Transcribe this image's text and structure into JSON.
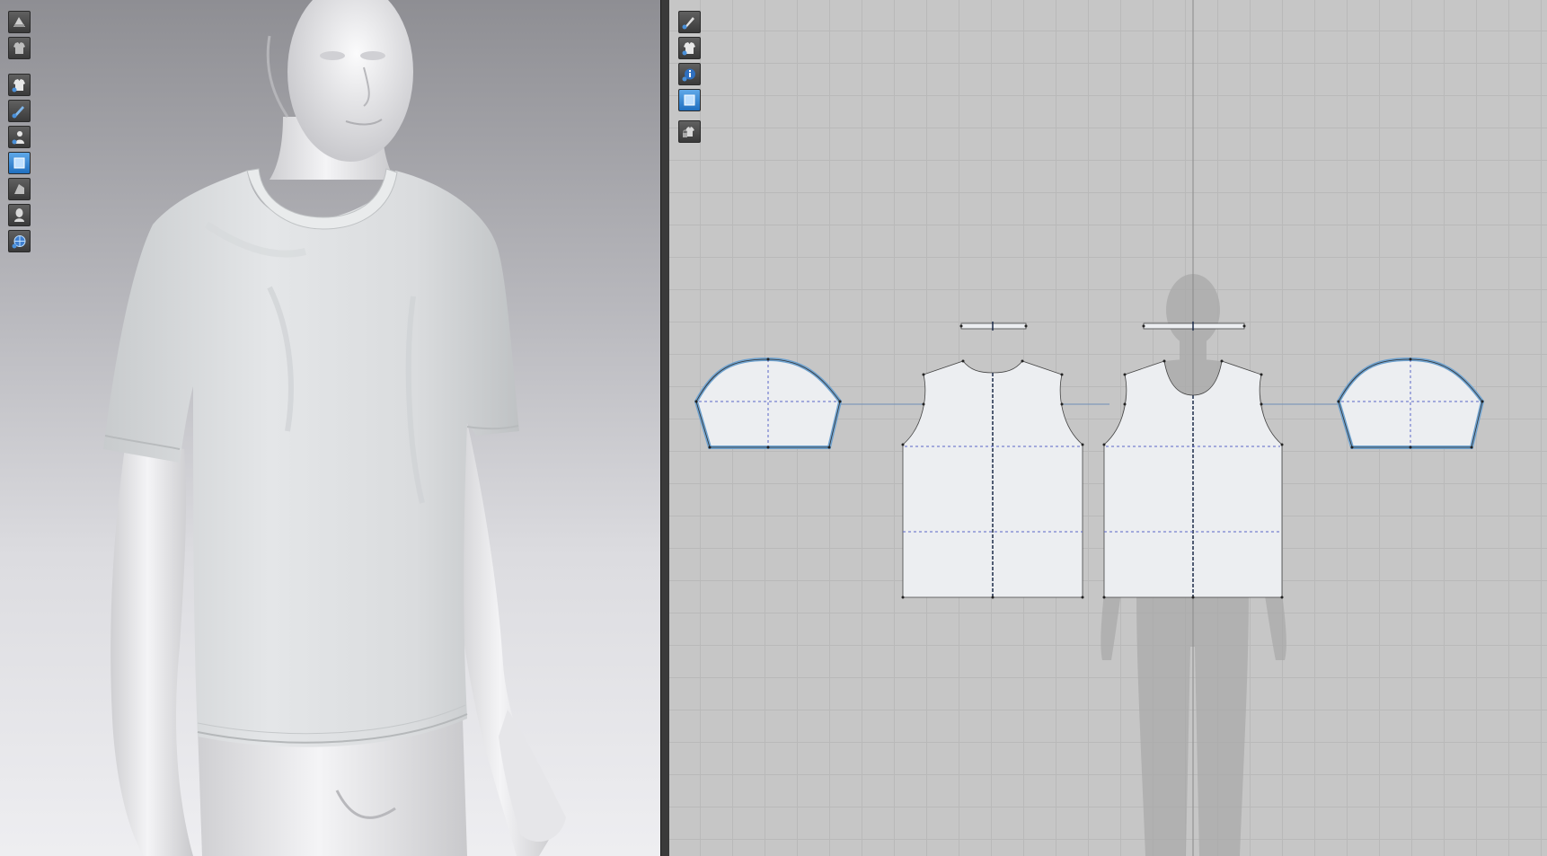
{
  "app": {
    "panes": [
      "3d-garment-view",
      "2d-pattern-view"
    ]
  },
  "toolbar_3d": {
    "buttons": [
      {
        "icon": "fabric-render-icon",
        "active": false
      },
      {
        "icon": "garment-display-icon",
        "active": false
      },
      {
        "icon": "show-garment-icon",
        "active": false
      },
      {
        "icon": "show-brush-icon",
        "active": false
      },
      {
        "icon": "show-avatar-icon",
        "active": false
      },
      {
        "icon": "texture-view-icon",
        "active": true
      },
      {
        "icon": "shading-mode-icon",
        "active": false
      },
      {
        "icon": "avatar-silhouette-icon",
        "active": false
      },
      {
        "icon": "mesh-globe-icon",
        "active": false
      }
    ]
  },
  "toolbar_2d": {
    "buttons": [
      {
        "icon": "edit-pen-icon",
        "active": false
      },
      {
        "icon": "show-pattern-icon",
        "active": false
      },
      {
        "icon": "info-icon",
        "active": false
      },
      {
        "icon": "texture-2d-icon",
        "active": true
      },
      {
        "icon": "lock-pattern-icon",
        "active": false
      }
    ]
  },
  "patterns": {
    "pieces": [
      "left-sleeve",
      "front-bodice",
      "back-bodice",
      "right-sleeve",
      "front-neckband",
      "back-neckband"
    ],
    "colors": {
      "fabric": "#eceef1",
      "seam_highlight": "#6fa2cf",
      "internal_line": "#5a66c8",
      "center_line": "#1b2a48",
      "avatar_silhouette": "#a8a8a8"
    }
  }
}
